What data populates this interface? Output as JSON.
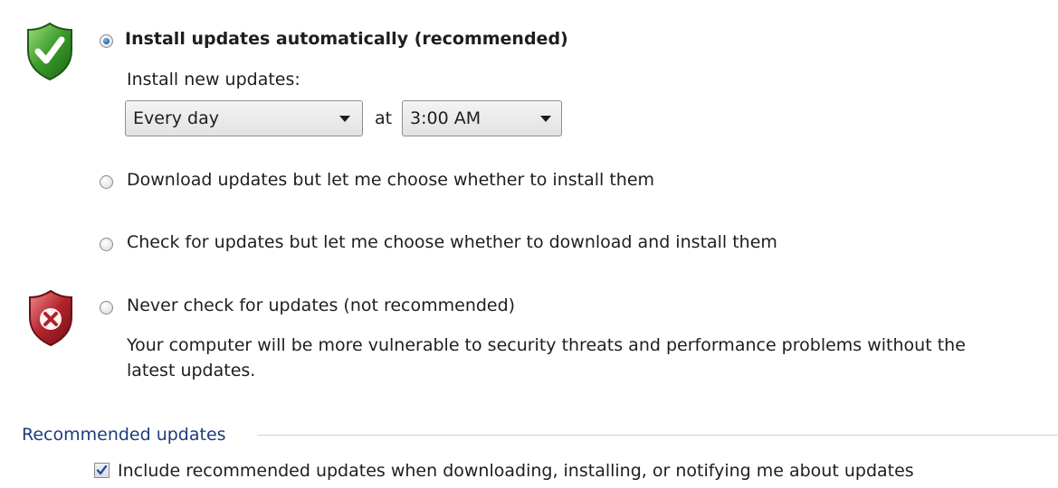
{
  "options": {
    "auto": {
      "label": "Install updates automatically (recommended)",
      "selected": true,
      "schedule_label": "Install new updates:",
      "frequency": "Every day",
      "at_label": "at",
      "time": "3:00 AM"
    },
    "download_only": {
      "label": "Download updates but let me choose whether to install them",
      "selected": false
    },
    "check_only": {
      "label": "Check for updates but let me choose whether to download and install them",
      "selected": false
    },
    "never": {
      "label": "Never check for updates (not recommended)",
      "selected": false,
      "warning_line1": "Your computer will be more vulnerable to security threats and performance problems without the",
      "warning_line2": "latest updates."
    }
  },
  "recommended": {
    "title": "Recommended updates",
    "checkbox_label": "Include recommended updates when downloading, installing, or notifying me about updates",
    "checked": true
  },
  "icons": {
    "good_shield": "green-shield-check-icon",
    "bad_shield": "red-shield-x-icon"
  },
  "colors": {
    "group_title": "#1e3c7a",
    "shield_green": "#3a9a2a",
    "shield_red": "#b3232b",
    "radio_dot": "#2c6fbf"
  }
}
